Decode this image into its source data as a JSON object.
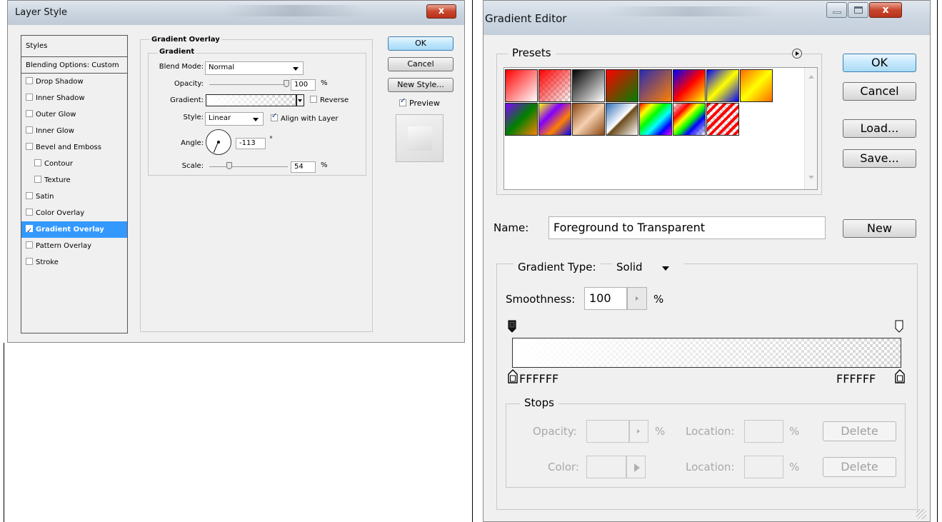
{
  "layer_style": {
    "title": "Layer Style",
    "close_label": "x",
    "styles_header": "Styles",
    "blending_options": "Blending Options: Custom",
    "effects": [
      {
        "label": "Drop Shadow",
        "checked": false,
        "indent": false
      },
      {
        "label": "Inner Shadow",
        "checked": false,
        "indent": false
      },
      {
        "label": "Outer Glow",
        "checked": false,
        "indent": false
      },
      {
        "label": "Inner Glow",
        "checked": false,
        "indent": false
      },
      {
        "label": "Bevel and Emboss",
        "checked": false,
        "indent": false
      },
      {
        "label": "Contour",
        "checked": false,
        "indent": true
      },
      {
        "label": "Texture",
        "checked": false,
        "indent": true
      },
      {
        "label": "Satin",
        "checked": false,
        "indent": false
      },
      {
        "label": "Color Overlay",
        "checked": false,
        "indent": false
      },
      {
        "label": "Gradient Overlay",
        "checked": true,
        "indent": false,
        "selected": true
      },
      {
        "label": "Pattern Overlay",
        "checked": false,
        "indent": false
      },
      {
        "label": "Stroke",
        "checked": false,
        "indent": false
      }
    ],
    "section_title": "Gradient Overlay",
    "subsection_title": "Gradient",
    "blend_mode_label": "Blend Mode:",
    "blend_mode_value": "Normal",
    "opacity_label": "Opacity:",
    "opacity_value": "100",
    "opacity_unit": "%",
    "gradient_label": "Gradient:",
    "reverse_label": "Reverse",
    "reverse_checked": false,
    "style_label": "Style:",
    "style_value": "Linear",
    "align_label": "Align with Layer",
    "align_checked": true,
    "angle_label": "Angle:",
    "angle_value": "-113",
    "angle_unit": "°",
    "scale_label": "Scale:",
    "scale_value": "54",
    "scale_unit": "%",
    "ok_label": "OK",
    "cancel_label": "Cancel",
    "new_style_label": "New Style...",
    "preview_label": "Preview",
    "preview_checked": true
  },
  "gradient_editor": {
    "title": "Gradient Editor",
    "presets_label": "Presets",
    "ok_label": "OK",
    "cancel_label": "Cancel",
    "load_label": "Load...",
    "save_label": "Save...",
    "presets": [
      {
        "name": "foreground-to-background",
        "colors": "linear-gradient(135deg,#ff0000 0%,#ffffff 100%)"
      },
      {
        "name": "foreground-to-transparent",
        "colors": "linear-gradient(135deg,#ff0000 0%,rgba(255,0,0,0) 100%)",
        "checker": true
      },
      {
        "name": "black-white",
        "colors": "linear-gradient(135deg,#000000 0%,#ffffff 100%)"
      },
      {
        "name": "red-green",
        "colors": "linear-gradient(135deg,#ff0000 0%,#008000 100%)"
      },
      {
        "name": "violet-orange",
        "colors": "linear-gradient(135deg,#2a2ab0 0%,#ff8000 100%)"
      },
      {
        "name": "blue-red-yellow",
        "colors": "linear-gradient(135deg,#0000ff 0%,#ff0000 50%,#ffff00 100%)"
      },
      {
        "name": "blue-yellow-blue",
        "colors": "linear-gradient(135deg,#0000ff 0%,#ffff00 50%,#0000ff 100%)"
      },
      {
        "name": "orange-yellow-orange",
        "colors": "linear-gradient(135deg,#ff6a00 0%,#ffff00 50%,#ff6a00 100%)"
      },
      {
        "name": "violet-green-orange",
        "colors": "linear-gradient(135deg,#8000ff 0%,#008000 50%,#ff8000 100%)"
      },
      {
        "name": "yellow-violet-orange-blue",
        "colors": "linear-gradient(135deg,#ffff00 0%,#8000ff 35%,#ff8000 65%,#0000ff 100%)"
      },
      {
        "name": "copper",
        "colors": "linear-gradient(135deg,#8b4513 0%,#f5d0b0 50%,#8b4513 100%)"
      },
      {
        "name": "chrome",
        "colors": "linear-gradient(135deg,#2f6fb5 0%,#ffffff 48%,#6b4a1a 52%,#ffffff 100%)"
      },
      {
        "name": "spectrum",
        "colors": "linear-gradient(135deg,#ff0000 0%,#ffff00 20%,#00ff00 40%,#00ffff 60%,#0000ff 80%,#ff00ff 100%)"
      },
      {
        "name": "transparent-rainbow",
        "colors": "linear-gradient(135deg,rgba(255,0,0,0) 0%,#ff0000 25%,#ffff00 40%,#00ff00 55%,#0000ff 70%,rgba(255,0,255,0) 100%)",
        "checker": true
      },
      {
        "name": "transparent-stripes",
        "colors": "repeating-linear-gradient(135deg,#ff0000 0px,#ff0000 4px,rgba(255,255,255,0) 4px,rgba(255,255,255,0) 8px)",
        "checker": true
      }
    ],
    "name_label": "Name:",
    "name_value": "Foreground to Transparent",
    "new_label": "New",
    "gradient_type_label": "Gradient Type:",
    "gradient_type_value": "Solid",
    "smoothness_label": "Smoothness:",
    "smoothness_value": "100",
    "smoothness_unit": "%",
    "left_stop_color": "FFFFFF",
    "right_stop_color": "FFFFFF",
    "stops_label": "Stops",
    "opacity_label": "Opacity:",
    "opacity_unit": "%",
    "location_label": "Location:",
    "location_unit": "%",
    "color_label": "Color:",
    "delete_label": "Delete"
  }
}
